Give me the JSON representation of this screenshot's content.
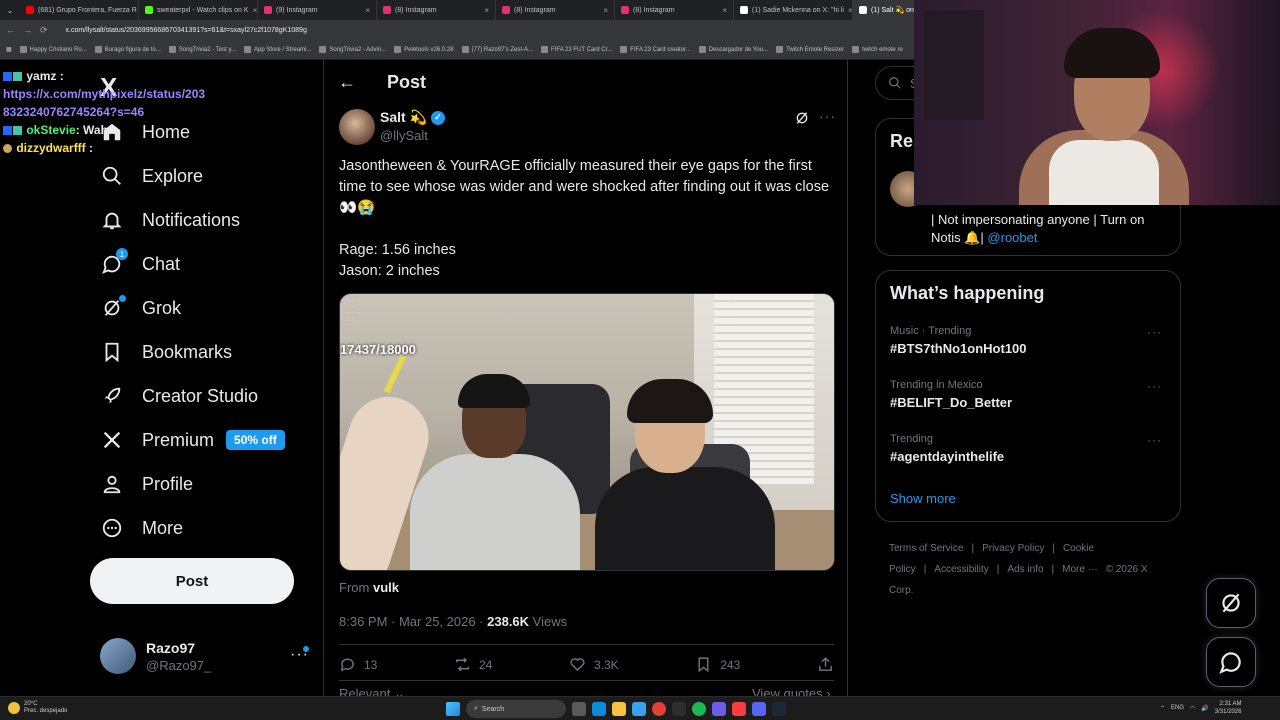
{
  "browser": {
    "tabs": [
      {
        "label": "(681) Grupo Frontera, Fuerza R",
        "color": "#ff0000"
      },
      {
        "label": "sweaterpxl - Watch clips on K",
        "color": "#53fc18"
      },
      {
        "label": "(9) Instagram",
        "color": "#e1306c"
      },
      {
        "label": "(8) Instagram",
        "color": "#e1306c"
      },
      {
        "label": "(8) Instagram",
        "color": "#e1306c"
      },
      {
        "label": "(8) Instagram",
        "color": "#e1306c"
      },
      {
        "label": "(1) Sadie Mckenna on X: \"hi li",
        "color": "#ffffff"
      },
      {
        "label": "(1) Salt 💫 on X: \"",
        "color": "#ffffff"
      }
    ],
    "url": "x.com/llysalt/status/2036995668670341391?s=61&t=sxayl27c2f1078gK1089g",
    "bookmarks": [
      "Happy Cristiano Ro...",
      "Burago figura de to...",
      "SongTrivia2 - Test y...",
      "App Store / Streami...",
      "SongTrivia2 - Advin...",
      "Peletools v26.0.28",
      "(77) Razo97's Zest-A...",
      "FIFA 23 FUT Card Cr...",
      "FIFA 23 Card creator...",
      "Descargador de You...",
      "Twitch Emote Resizer",
      "twitch emote re"
    ]
  },
  "chat": [
    {
      "user": "yamz",
      "text": ":"
    },
    {
      "link": "https://x.com/mythpixelz/status/2038323240762745264?s=46"
    },
    {
      "user": "okStevie",
      "text": ": Wah"
    },
    {
      "user": "dizzydwarfff",
      "text": ":"
    }
  ],
  "nav": {
    "logo": "X",
    "items": [
      {
        "label": "Home",
        "icon": "home-icon"
      },
      {
        "label": "Explore",
        "icon": "search-icon"
      },
      {
        "label": "Notifications",
        "icon": "bell-icon"
      },
      {
        "label": "Chat",
        "icon": "chat-icon",
        "badge": "1"
      },
      {
        "label": "Grok",
        "icon": "grok-icon"
      },
      {
        "label": "Bookmarks",
        "icon": "bookmark-icon"
      },
      {
        "label": "Creator Studio",
        "icon": "rocket-icon"
      },
      {
        "label": "Premium",
        "icon": "x-logo-icon",
        "badge_text": "50% off"
      },
      {
        "label": "Profile",
        "icon": "person-icon"
      },
      {
        "label": "More",
        "icon": "more-circle-icon"
      }
    ],
    "post_button": "Post",
    "account": {
      "name": "Razo97",
      "handle": "@Razo97_"
    }
  },
  "main": {
    "header_title": "Post",
    "author": {
      "name": "Salt 💫",
      "handle": "@llySalt"
    },
    "text_line1": "Jasontheween & YourRAGE officially measured their eye gaps for the first time to see whose was wider and were shocked after finding out it was close 👀😭",
    "text_line2": "Rage: 1.56 inches",
    "text_line3": "Jason: 2 inches",
    "media_counter": "17437/18000",
    "from_label": "From",
    "from_name": "vulk",
    "timestamp": "8:36 PM · Mar 25, 2026 · ",
    "views_count": "238.6K",
    "views_label": " Views",
    "actions": {
      "replies": "13",
      "reposts": "24",
      "likes": "3.3K",
      "bookmarks": "243"
    },
    "relevant": "Relevant ⌄",
    "view_quotes": "View quotes ›"
  },
  "right": {
    "search_placeholder": "Se",
    "relevant_title": "Rel",
    "relevant_bio": "| Not impersonating anyone | Turn on Notis 🔔|",
    "relevant_mention": "@roobet",
    "trending_title": "What’s happening",
    "trends": [
      {
        "context": "Music · Trending",
        "tag": "#BTS7thNo1onHot100"
      },
      {
        "context": "Trending in Mexico",
        "tag": "#BELIFT_Do_Better"
      },
      {
        "context": "Trending",
        "tag": "#agentdayinthelife"
      }
    ],
    "show_more": "Show more",
    "footer": [
      "Terms of Service",
      "|",
      "Privacy Policy",
      "|",
      "Cookie Policy",
      "|",
      "Accessibility",
      "|",
      "Ads info",
      "|",
      "More ···",
      "© 2026 X Corp."
    ]
  },
  "taskbar": {
    "weather_temp": "20°C",
    "weather_desc": "Prec. despejado",
    "search": "Search",
    "lang": "ENG",
    "time": "2:31 AM",
    "date": "3/31/2026"
  },
  "colors": {
    "accent": "#1d9bf0",
    "background": "#000000",
    "text": "#e7e9ea",
    "muted": "#71767b"
  }
}
